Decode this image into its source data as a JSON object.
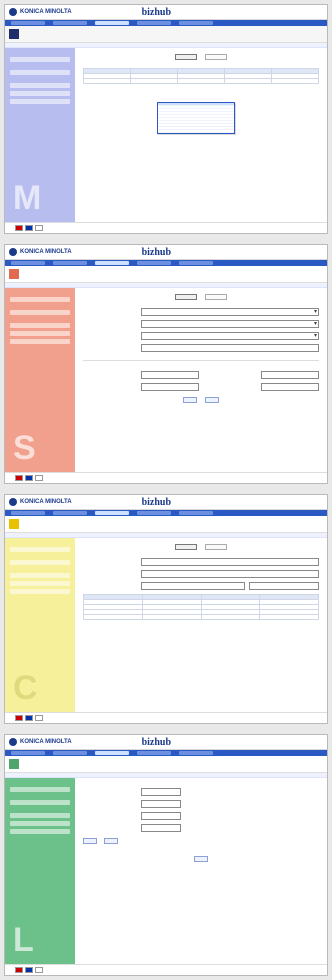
{
  "header": {
    "brand": "KONICA MINOLTA",
    "product": "bizhub"
  },
  "screens": [
    {
      "id": "M",
      "letter": "M",
      "accent": "#7f86d6",
      "sidebar_bg": "#b8bdf0",
      "title": "",
      "info": "",
      "tabs": [
        "",
        ""
      ],
      "dropdown_options": [
        "",
        "",
        "",
        "",
        "",
        "",
        "",
        "",
        "",
        ""
      ]
    },
    {
      "id": "S",
      "letter": "S",
      "accent": "#e06b50",
      "sidebar_bg": "#f1a08d",
      "title": "",
      "info": "",
      "tabs": [
        "",
        ""
      ],
      "buttons": [
        "",
        ""
      ]
    },
    {
      "id": "C",
      "letter": "C",
      "accent": "#f3e26e",
      "sidebar_bg": "#f7f09a",
      "title": "",
      "info": "",
      "tabs": [
        "",
        ""
      ],
      "table": {
        "headers": [
          "",
          "",
          "",
          ""
        ],
        "rows": [
          [
            "",
            "",
            "",
            ""
          ],
          [
            "",
            "",
            "",
            ""
          ],
          [
            "",
            "",
            "",
            ""
          ],
          [
            "",
            "",
            "",
            ""
          ]
        ]
      }
    },
    {
      "id": "L",
      "letter": "L",
      "accent": "#4fa56b",
      "sidebar_bg": "#6cc08a",
      "title": "",
      "info": "",
      "buttons": [
        "",
        ""
      ]
    }
  ]
}
